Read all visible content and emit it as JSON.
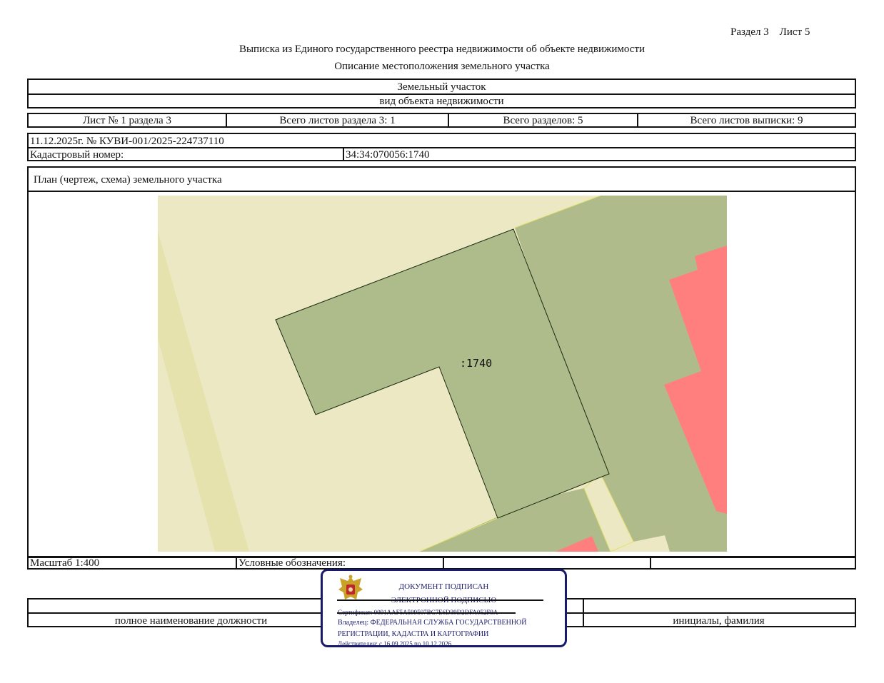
{
  "header": {
    "section_sheet": "Раздел 3    Лист 5",
    "title": "Выписка из Единого государственного реестра недвижимости об объекте недвижимости",
    "subtitle": "Описание местоположения земельного участка"
  },
  "object": {
    "type_value": "Земельный участок",
    "type_caption": "вид объекта недвижимости"
  },
  "sheets": {
    "sheet_no": "Лист № 1 раздела 3",
    "total_sheets_section": "Всего листов раздела 3: 1",
    "total_sections": "Всего разделов: 5",
    "total_sheets_extract": "Всего листов выписки: 9"
  },
  "record": {
    "date_number": "11.12.2025г. № КУВИ-001/2025-224737110",
    "cadastral_label": "Кадастровый номер:",
    "cadastral_value": "34:34:070056:1740"
  },
  "plan": {
    "title": "План (чертеж, схема) земельного участка",
    "parcel_label": ":1740",
    "colors": {
      "background": "#ede8c4",
      "parcel": "#adbc8a",
      "neighbor": "#b0bb8c",
      "building": "#ff7f7f",
      "road": "#e6e2ae"
    }
  },
  "footer": {
    "scale": "Масштаб 1:400",
    "legend_label": "Условные обозначения:",
    "position_caption": "полное наименование должности",
    "name_caption": "инициалы, фамилия"
  },
  "stamp": {
    "emblem": "russian-coat-of-arms-icon",
    "line1": "ДОКУМЕНТ ПОДПИСАН",
    "line2": "ЭЛЕКТРОННОЙ ПОДПИСЬЮ",
    "certificate": "Сертификат: 0091AAF5A599507BC7E6D39D2DFA052F9A",
    "owner1": "Владелец: ФЕДЕРАЛЬНАЯ СЛУЖБА ГОСУДАРСТВЕННОЙ",
    "owner2": "РЕГИСТРАЦИИ, КАДАСТРА И КАРТОГРАФИИ",
    "validity": "Действителен: с 16.09.2025 по 10.12.2026"
  }
}
